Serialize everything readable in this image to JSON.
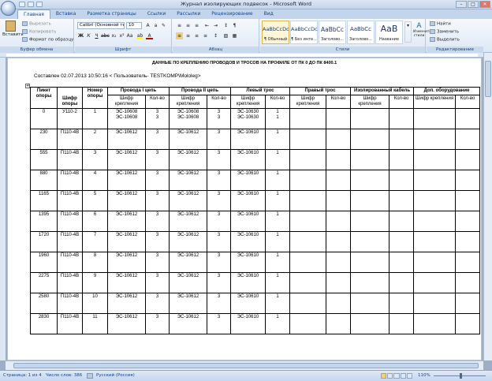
{
  "window": {
    "title": "Журнал изолирующих подвесок - Microsoft Word"
  },
  "tabs": [
    "Главная",
    "Вставка",
    "Разметка страницы",
    "Ссылки",
    "Рассылки",
    "Рецензирование",
    "Вид"
  ],
  "ribbon": {
    "clipboard": {
      "label": "Буфер обмена",
      "paste": "Вставить",
      "cut": "Вырезать",
      "copy": "Копировать",
      "format_painter": "Формат по образцу"
    },
    "font": {
      "label": "Шрифт",
      "name": "Calibri (Основной те",
      "size": "10"
    },
    "paragraph": {
      "label": "Абзац"
    },
    "styles": {
      "label": "Стили",
      "items": [
        {
          "sample": "AaBbCcDc",
          "name": "¶ Обычный"
        },
        {
          "sample": "AaBbCcDc",
          "name": "¶ Без инте..."
        },
        {
          "sample": "AaBbCc",
          "name": "Заголово..."
        },
        {
          "sample": "AaBbCc",
          "name": "Заголово..."
        },
        {
          "sample": "AaB",
          "name": "Название"
        }
      ],
      "change_styles": "Изменить стили"
    },
    "editing": {
      "label": "Редактирование",
      "find": "Найти",
      "replace": "Заменить",
      "select": "Выделить"
    }
  },
  "document": {
    "title": "ДАННЫЕ ПО КРЕПЛЕНИЮ ПРОВОДОВ И ТРОСОВ НА ПРОФИЛЕ ОТ ПК  0 ДО ПК  8400.1",
    "author_line": "Составлен 02.07.2013 10:50:16  < Пользователь- TESTKOMP\\Mololeg>",
    "table": {
      "headers": {
        "picket": "Пикет опоры",
        "cipher": "Шифр опоры",
        "number": "Номер опоры",
        "wire1": "Провода I цепь",
        "wire2": "Провода II цепь",
        "left_rope": "Левый трос",
        "right_rope": "Правый трос",
        "insulated": "Изолированный кабель",
        "extra": "Доп. оборудование"
      },
      "sub": {
        "mount": "Шифр крепления",
        "qty": "Кол-во"
      },
      "rows": [
        {
          "picket": "0",
          "cipher": "У110-2",
          "num": "1",
          "w1m": "ЭС-10608\nЭС-10608",
          "w1q": "3\n3",
          "w2m": "ЭС-10608\nЭС-10608",
          "w2q": "3\n3",
          "lm": "ЭС-10630\nЭС-10630",
          "lq": "1\n1"
        },
        {
          "picket": "230",
          "cipher": "П110-4В",
          "num": "2",
          "w1m": "ЭС-10612",
          "w1q": "3",
          "w2m": "ЭС-10612",
          "w2q": "3",
          "lm": "ЭС-10610",
          "lq": "1"
        },
        {
          "picket": "555",
          "cipher": "П110-4В",
          "num": "3",
          "w1m": "ЭС-10612",
          "w1q": "3",
          "w2m": "ЭС-10612",
          "w2q": "3",
          "lm": "ЭС-10610",
          "lq": "1"
        },
        {
          "picket": "880",
          "cipher": "П110-4В",
          "num": "4",
          "w1m": "ЭС-10612",
          "w1q": "3",
          "w2m": "ЭС-10612",
          "w2q": "3",
          "lm": "ЭС-10610",
          "lq": "1"
        },
        {
          "picket": "1165",
          "cipher": "П110-4В",
          "num": "5",
          "w1m": "ЭС-10612",
          "w1q": "3",
          "w2m": "ЭС-10612",
          "w2q": "3",
          "lm": "ЭС-10610",
          "lq": "1"
        },
        {
          "picket": "1395",
          "cipher": "П110-4В",
          "num": "6",
          "w1m": "ЭС-10612",
          "w1q": "3",
          "w2m": "ЭС-10612",
          "w2q": "3",
          "lm": "ЭС-10610",
          "lq": "1"
        },
        {
          "picket": "1720",
          "cipher": "П110-4В",
          "num": "7",
          "w1m": "ЭС-10612",
          "w1q": "3",
          "w2m": "ЭС-10612",
          "w2q": "3",
          "lm": "ЭС-10610",
          "lq": "1"
        },
        {
          "picket": "1960",
          "cipher": "П110-4В",
          "num": "8",
          "w1m": "ЭС-10612",
          "w1q": "3",
          "w2m": "ЭС-10612",
          "w2q": "3",
          "lm": "ЭС-10610",
          "lq": "1"
        },
        {
          "picket": "2275",
          "cipher": "П110-4В",
          "num": "9",
          "w1m": "ЭС-10612",
          "w1q": "3",
          "w2m": "ЭС-10612",
          "w2q": "3",
          "lm": "ЭС-10610",
          "lq": "1"
        },
        {
          "picket": "2580",
          "cipher": "П110-4В",
          "num": "10",
          "w1m": "ЭС-10612",
          "w1q": "3",
          "w2m": "ЭС-10612",
          "w2q": "3",
          "lm": "ЭС-10610",
          "lq": "1"
        },
        {
          "picket": "2830",
          "cipher": "П110-4В",
          "num": "11",
          "w1m": "ЭС-10612",
          "w1q": "3",
          "w2m": "ЭС-10612",
          "w2q": "3",
          "lm": "ЭС-10610",
          "lq": "1"
        }
      ]
    }
  },
  "status": {
    "page": "Страница: 1 из 4",
    "words": "Число слов: 386",
    "language": "Русский (Россия)",
    "zoom": "110%"
  }
}
